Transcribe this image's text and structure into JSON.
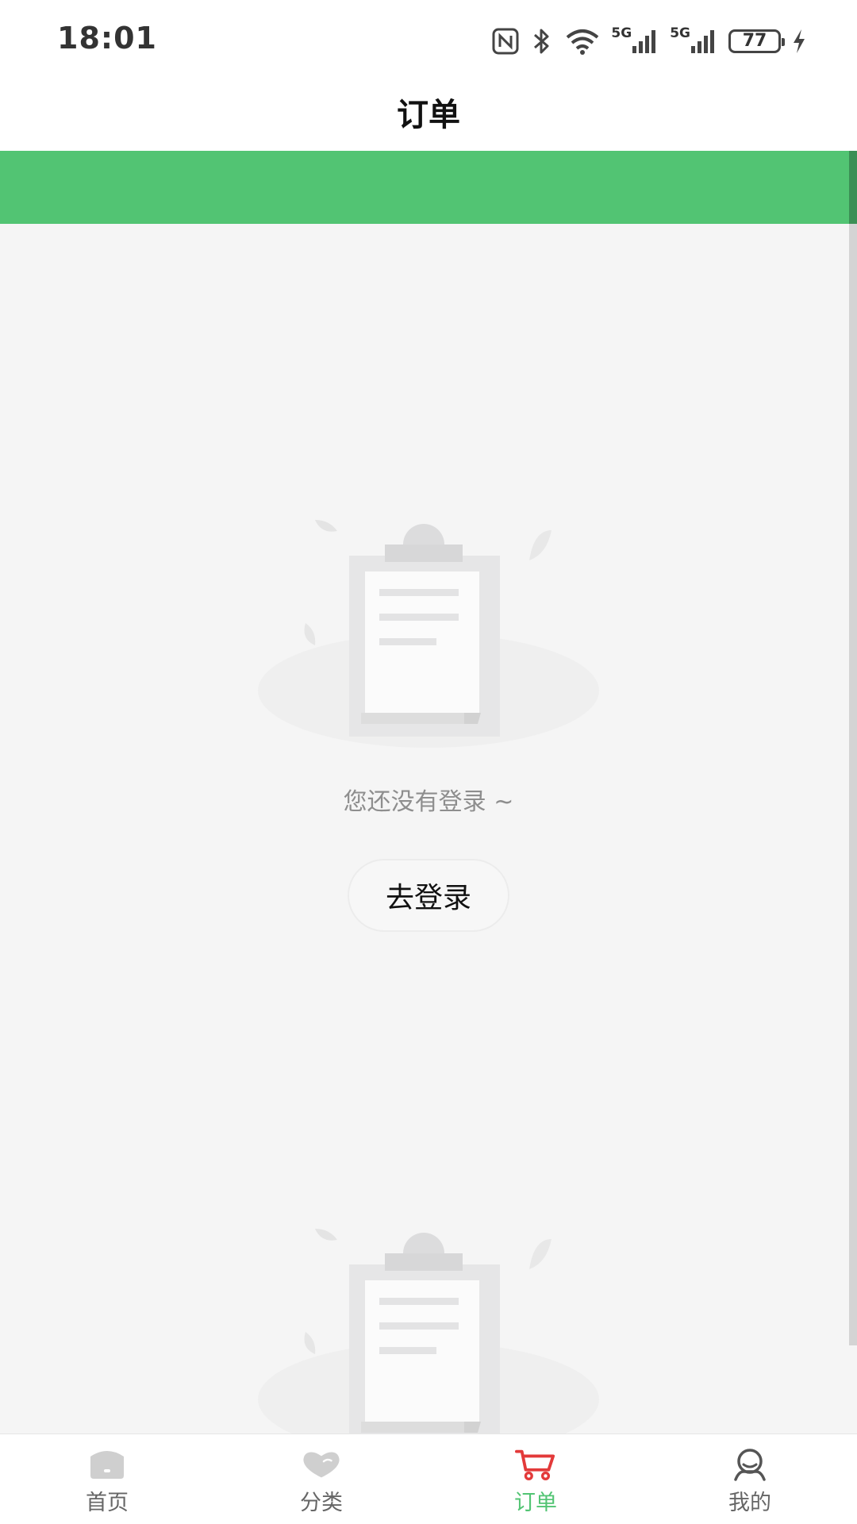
{
  "status_bar": {
    "time": "18:01",
    "battery": "77",
    "network_1": "5G",
    "network_2": "5G",
    "icons": [
      "nfc-icon",
      "bluetooth-icon",
      "wifi-icon",
      "signal-icon",
      "battery-icon",
      "charging-icon"
    ]
  },
  "header": {
    "title": "订单"
  },
  "empty_state": {
    "message": "您还没有登录 ~",
    "login_label": "去登录",
    "illustration_icon": "empty-clipboard-illustration"
  },
  "tab_bar": {
    "active_index": 2,
    "active_color": "#52c473",
    "inactive_color": "#666666",
    "items": [
      {
        "label": "首页",
        "icon": "home-icon"
      },
      {
        "label": "分类",
        "icon": "heart-icon"
      },
      {
        "label": "订单",
        "icon": "cart-icon"
      },
      {
        "label": "我的",
        "icon": "profile-icon"
      }
    ]
  },
  "colors": {
    "accent_green": "#52c473",
    "cart_red": "#e33a3a",
    "background": "#f5f5f5"
  }
}
